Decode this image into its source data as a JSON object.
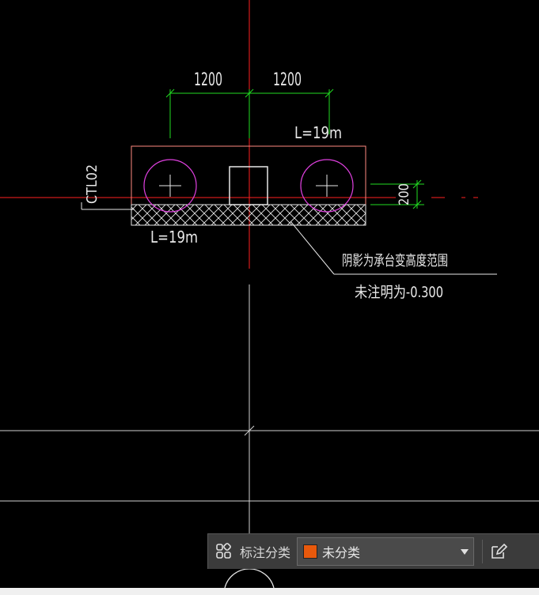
{
  "drawing": {
    "dim_left": "1200",
    "dim_right": "1200",
    "length_top": "L=19m",
    "length_bottom": "L=19m",
    "element_id": "CTL02",
    "dim_vertical": "200",
    "note_hatch": "阴影为承台变高度范围",
    "note_elevation": "未注明为-0.300"
  },
  "toolbar": {
    "label": "标注分类",
    "selected_value": "未分类",
    "selected_color": "#e8590c"
  },
  "colors": {
    "background": "#000000",
    "axis_red": "#ff2020",
    "dimension_green": "#22dd22",
    "outline_salmon": "#ff8a80",
    "pile_magenta": "#e040e0",
    "line_white": "#e8e8e8"
  }
}
